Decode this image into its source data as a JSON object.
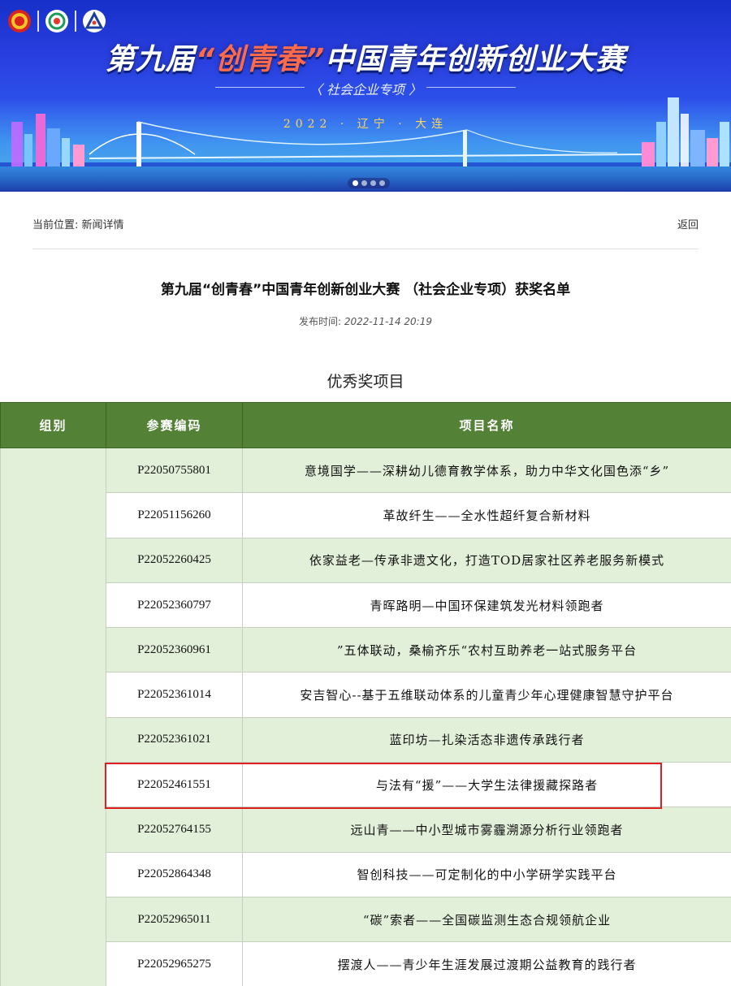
{
  "banner": {
    "title_part1": "第九届",
    "title_highlight": "“创青春”",
    "title_part2": "中国青年创新创业大赛",
    "subtitle": "〈 社会企业专项 〉",
    "location": "2022 · 辽宁 · 大连",
    "slide_count": 4,
    "active_slide": 1,
    "colors": {
      "title": "#ffffff",
      "highlight": "#ff6a4a",
      "place": "#ffd75a"
    }
  },
  "nav": {
    "location_label": "当前位置:",
    "location_page": "新闻详情",
    "back_label": "返回"
  },
  "article": {
    "title": "第九届“创青春”中国青年创新创业大赛 （社会企业专项）获奖名单",
    "publish_label": "发布时间:",
    "publish_time": "2022-11-14 20:19"
  },
  "section": {
    "title": "优秀奖项目"
  },
  "table": {
    "headers": [
      "组别",
      "参赛编码",
      "项目名称"
    ],
    "header_color": "#538135",
    "shade_color": "#e2efd9",
    "rows": [
      {
        "code": "P22050755801",
        "name": "意境国学——深耕幼儿德育教学体系，助力中华文化国色添“乡”"
      },
      {
        "code": "P22051156260",
        "name": "革故纤生——全水性超纤复合新材料"
      },
      {
        "code": "P22052260425",
        "name": "依家益老—传承非遗文化，打造TOD居家社区养老服务新模式"
      },
      {
        "code": "P22052360797",
        "name": "青晖路明—中国环保建筑发光材料领跑者"
      },
      {
        "code": "P22052360961",
        "name": "”五体联动，桑榆齐乐“农村互助养老一站式服务平台"
      },
      {
        "code": "P22052361014",
        "name": "安吉智心--基于五维联动体系的儿童青少年心理健康智慧守护平台"
      },
      {
        "code": "P22052361021",
        "name": "蓝印坊—扎染活态非遗传承践行者"
      },
      {
        "code": "P22052461551",
        "name": "与法有“援”——大学生法律援藏探路者",
        "highlighted": true
      },
      {
        "code": "P22052764155",
        "name": "远山青——中小型城市雾霾溯源分析行业领跑者"
      },
      {
        "code": "P22052864348",
        "name": "智创科技——可定制化的中小学研学实践平台"
      },
      {
        "code": "P22052965011",
        "name": "“碳”索者——全国碳监测生态合规领航企业"
      },
      {
        "code": "P22052965275",
        "name": "摆渡人——青少年生涯发展过渡期公益教育的践行者"
      }
    ],
    "highlight_color": "#e02020"
  }
}
